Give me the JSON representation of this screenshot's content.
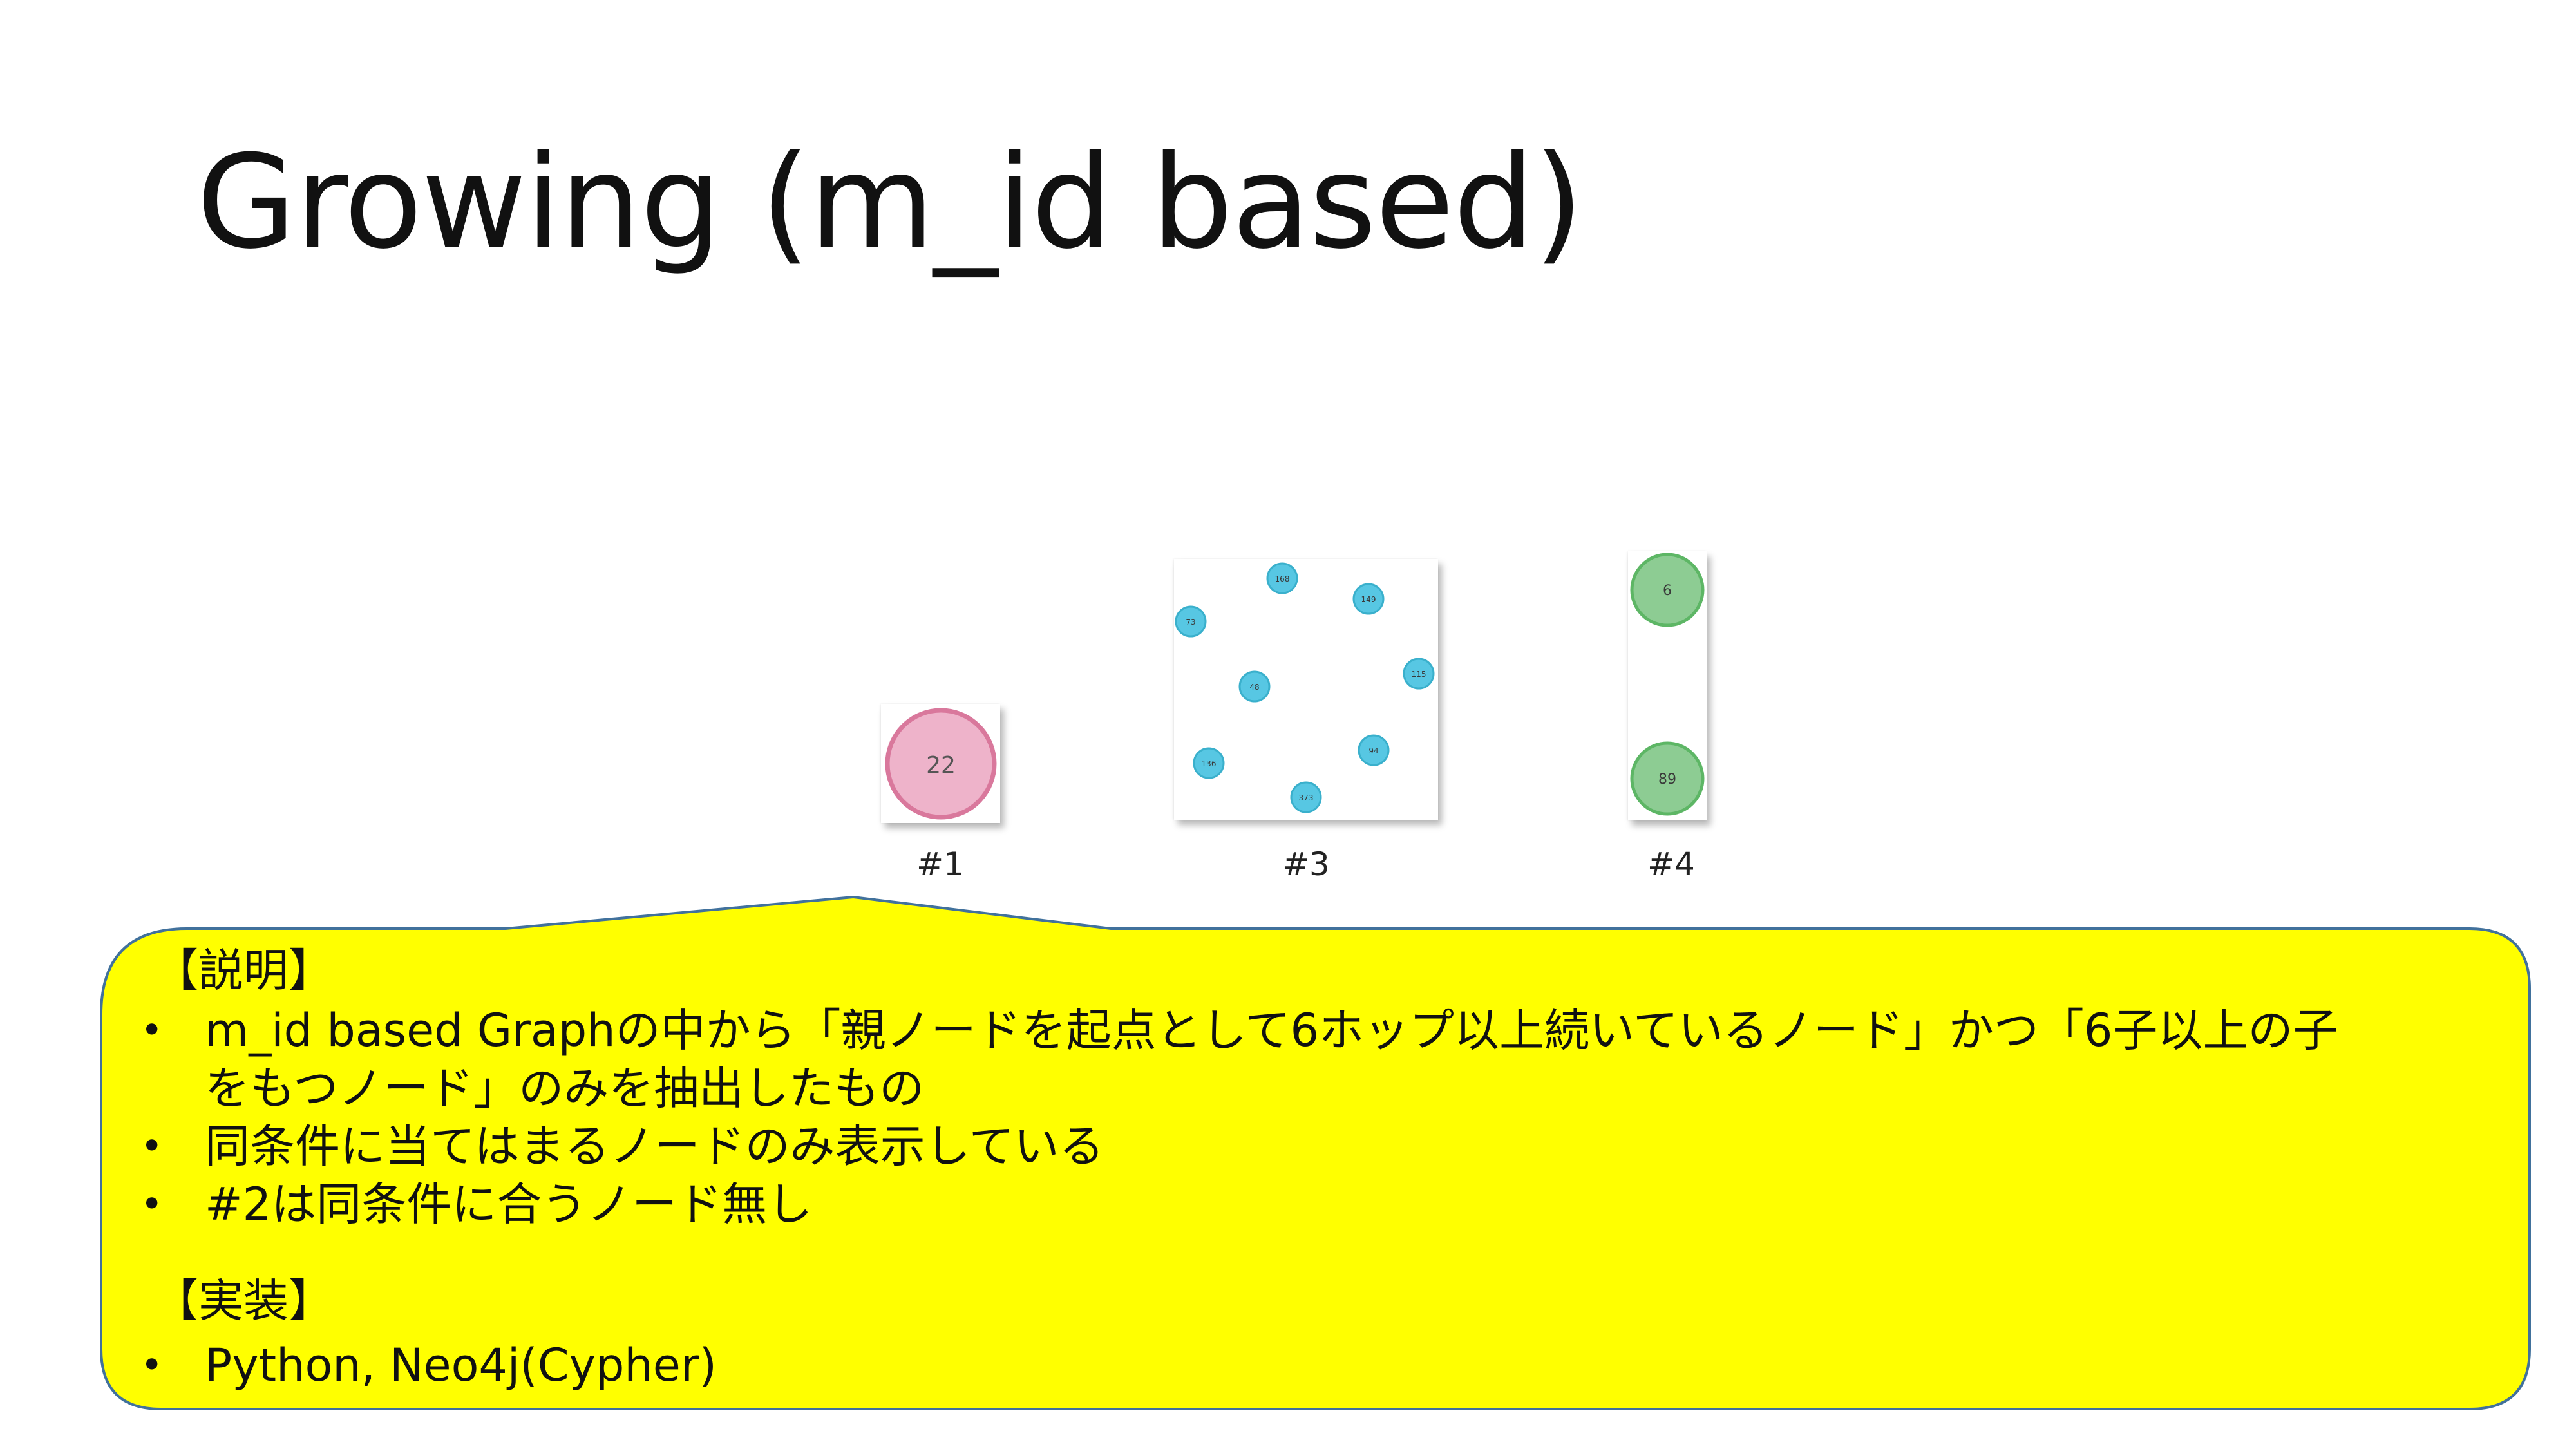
{
  "slide": {
    "title": "Growing (m_id based)"
  },
  "graphs": [
    {
      "caption": "#1",
      "nodes": [
        {
          "label": "22",
          "color": "#eeb3ca",
          "stroke": "#d9789c"
        }
      ]
    },
    {
      "caption": "#3",
      "nodes": [
        {
          "label": "168",
          "color": "#57c7e3",
          "stroke": "#3ab0cc"
        },
        {
          "label": "149",
          "color": "#57c7e3",
          "stroke": "#3ab0cc"
        },
        {
          "label": "73",
          "color": "#57c7e3",
          "stroke": "#3ab0cc"
        },
        {
          "label": "48",
          "color": "#57c7e3",
          "stroke": "#3ab0cc"
        },
        {
          "label": "115",
          "color": "#57c7e3",
          "stroke": "#3ab0cc"
        },
        {
          "label": "136",
          "color": "#57c7e3",
          "stroke": "#3ab0cc"
        },
        {
          "label": "94",
          "color": "#57c7e3",
          "stroke": "#3ab0cc"
        },
        {
          "label": "373",
          "color": "#57c7e3",
          "stroke": "#3ab0cc"
        }
      ]
    },
    {
      "caption": "#4",
      "nodes": [
        {
          "label": "6",
          "color": "#8dcc93",
          "stroke": "#5db665"
        },
        {
          "label": "89",
          "color": "#8dcc93",
          "stroke": "#5db665"
        }
      ]
    }
  ],
  "callout": {
    "fill": "#ffff00",
    "border": "#41719c",
    "section1_heading": "【説明】",
    "bullets1": [
      {
        "line1": "m_id based Graphの中から「親ノードを起点として6ホップ以上続いているノード」かつ「6子以上の子",
        "line2": "をもつノード」のみを抽出したもの"
      },
      {
        "line1": "同条件に当てはまるノードのみ表示している",
        "line2": ""
      },
      {
        "line1": "#2は同条件に合うノード無し",
        "line2": ""
      }
    ],
    "section2_heading": "【実装】",
    "bullets2": [
      {
        "line1": "Python, Neo4j(Cypher)",
        "line2": ""
      }
    ],
    "bullet_symbol": "•"
  }
}
